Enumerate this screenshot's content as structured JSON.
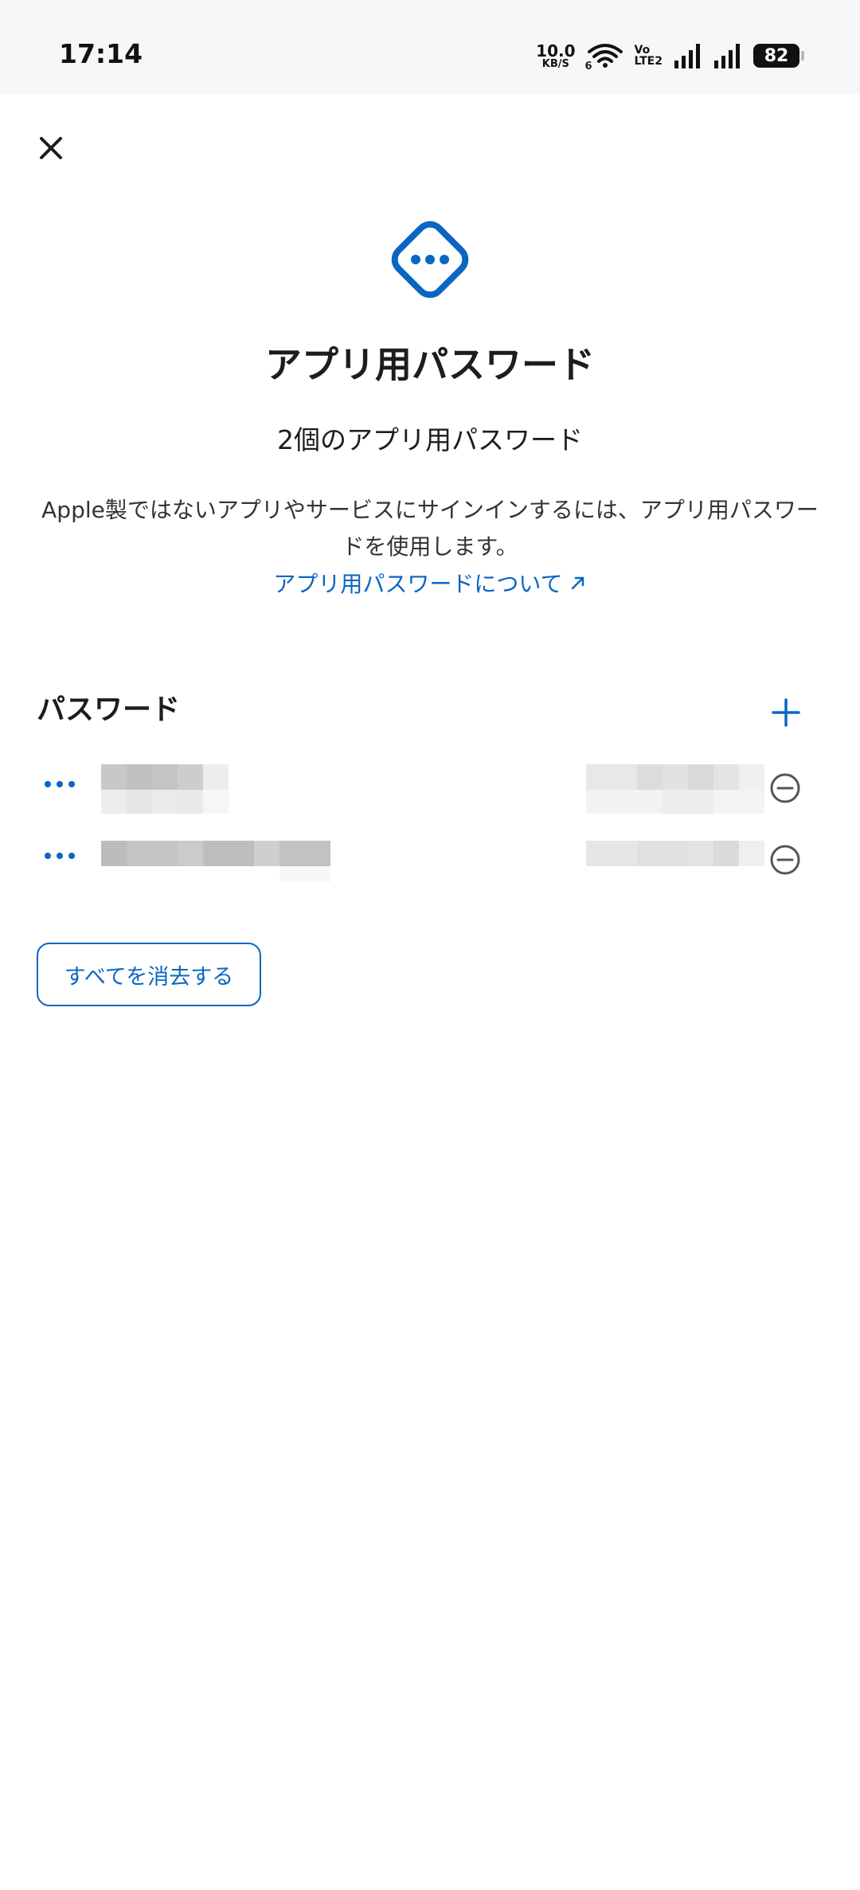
{
  "status_bar": {
    "time": "17:14",
    "net_speed_value": "10.0",
    "net_speed_unit": "KB/S",
    "wifi_label": "6",
    "volte_top": "Vo",
    "volte_bottom": "LTE2",
    "battery": "82"
  },
  "header": {
    "title": "アプリ用パスワード",
    "subtitle": "2個のアプリ用パスワード",
    "description": "Apple製ではないアプリやサービスにサインインするには、アプリ用パスワードを使用します。",
    "learn_more": "アプリ用パスワードについて"
  },
  "passwords": {
    "section_title": "パスワード"
  },
  "actions": {
    "clear_all": "すべてを消去する"
  },
  "colors": {
    "accent": "#0a66c2",
    "text": "#1d1d1f",
    "status_bar_bg": "#f7f7f9"
  },
  "icons": {
    "close": "close-icon",
    "hero": "app-password-diamond-icon",
    "add": "plus-icon",
    "more": "ellipsis-icon",
    "remove": "minus-circle-icon",
    "external": "external-link-arrow-icon"
  }
}
